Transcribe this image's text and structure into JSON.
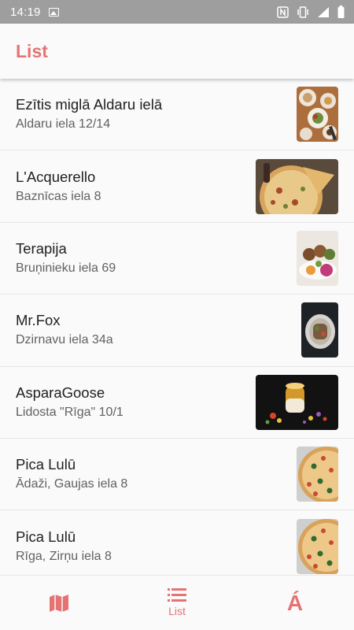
{
  "status_bar": {
    "time": "14:19"
  },
  "app_bar": {
    "title": "List"
  },
  "accent_color": "#e57373",
  "restaurants": [
    {
      "name": "Ezītis miglā Aldaru ielā",
      "address": "Aldaru iela 12/14",
      "image": "food-photo"
    },
    {
      "name": "L'Acquerello",
      "address": "Baznīcas iela 8",
      "image": "pizza-photo"
    },
    {
      "name": "Terapija",
      "address": "Bruņinieku iela 69",
      "image": "food-photo"
    },
    {
      "name": "Mr.Fox",
      "address": "Dzirnavu iela 34a",
      "image": "food-photo"
    },
    {
      "name": "AsparaGoose",
      "address": "Lidosta \"Rīga\" 10/1",
      "image": "dessert-photo"
    },
    {
      "name": "Pica Lulū",
      "address": "Ādaži, Gaujas iela 8",
      "image": "pizza-photo"
    },
    {
      "name": "Pica Lulū",
      "address": "Rīga, Zirņu iela 8",
      "image": "pizza-photo"
    }
  ],
  "bottom_nav": {
    "items": [
      {
        "icon": "map-icon",
        "label": ""
      },
      {
        "icon": "list-icon",
        "label": "List",
        "active": true
      },
      {
        "icon": "letter-a-icon",
        "glyph": "Á",
        "label": ""
      }
    ]
  }
}
